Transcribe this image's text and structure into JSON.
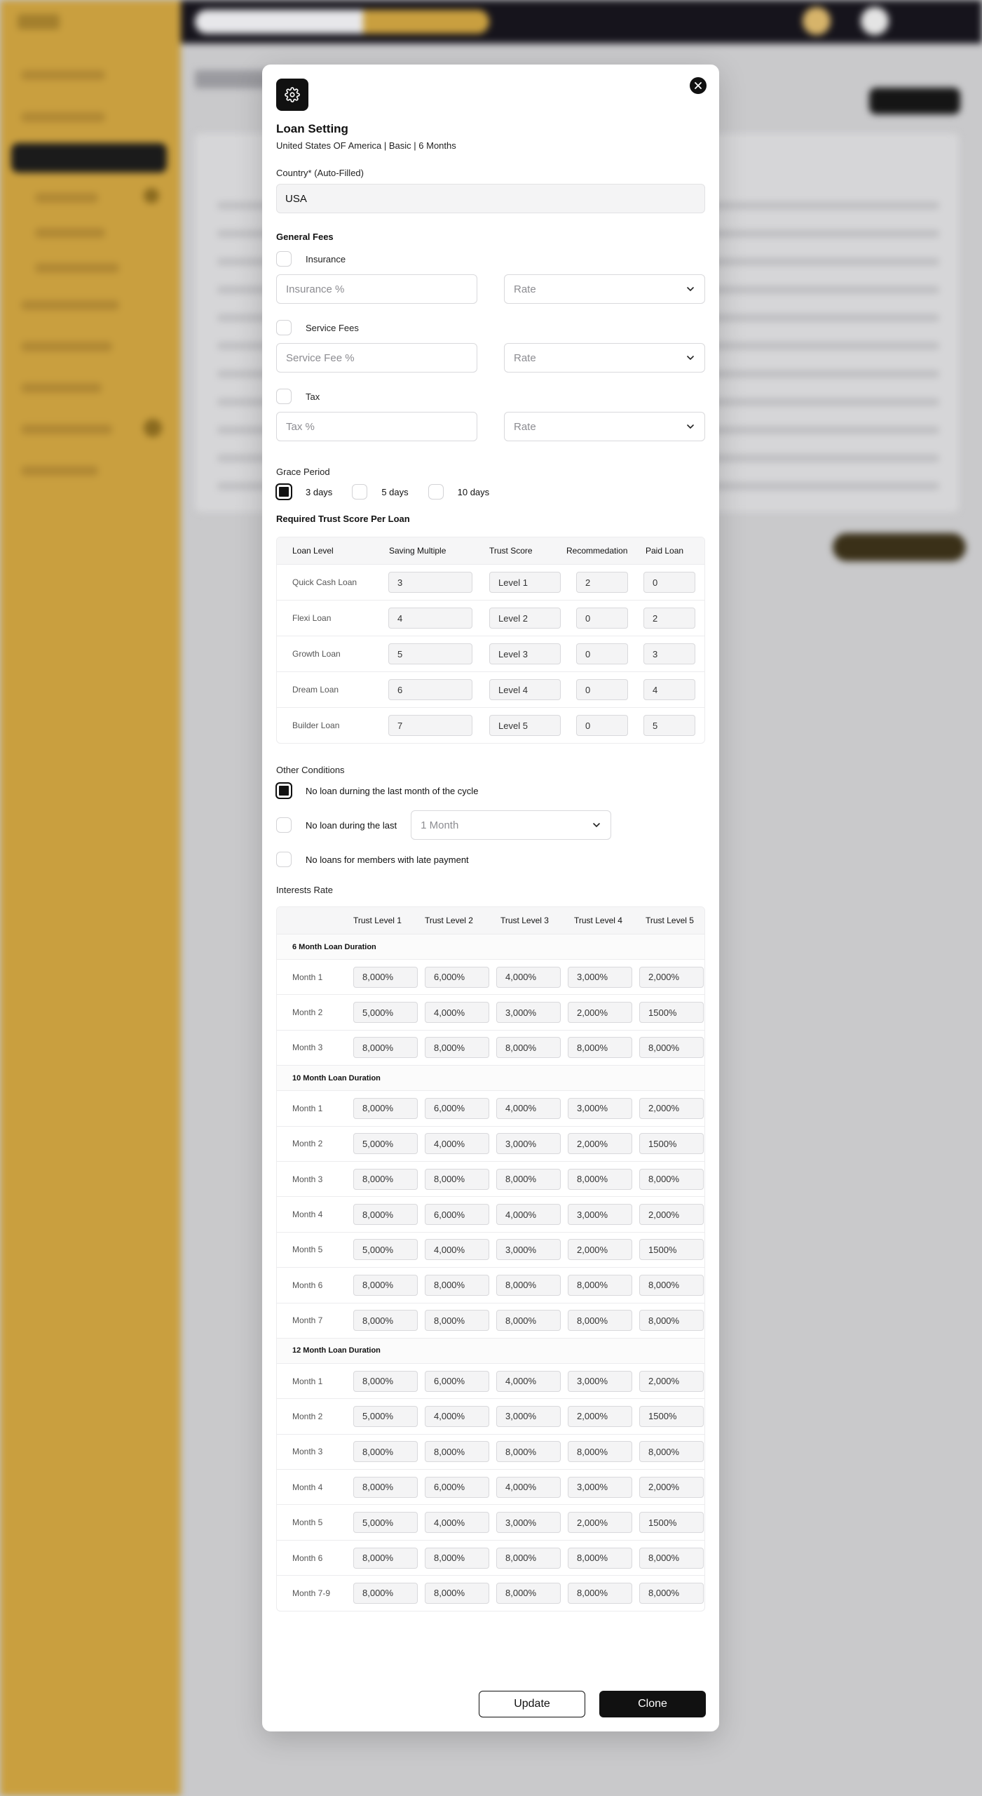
{
  "modal": {
    "title": "Loan Setting",
    "subtitle": "United States OF America | Basic | 6 Months",
    "country_label": "Country* (Auto-Filled)",
    "country_value": "USA"
  },
  "general_fees": {
    "label": "General Fees",
    "items": [
      {
        "name": "Insurance",
        "placeholder": "Insurance %",
        "select": "Rate"
      },
      {
        "name": "Service Fees",
        "placeholder": "Service Fee %",
        "select": "Rate"
      },
      {
        "name": "Tax",
        "placeholder": "Tax %",
        "select": "Rate"
      }
    ]
  },
  "grace_period": {
    "label": "Grace Period",
    "options": [
      "3 days",
      "5 days",
      "10 days"
    ],
    "selected": "3 days"
  },
  "trust_score": {
    "label": "Required Trust Score Per Loan",
    "headers": [
      "Loan Level",
      "Saving Multiple",
      "Trust Score",
      "Recommedation",
      "Paid Loan"
    ],
    "rows": [
      {
        "level": "Quick Cash Loan",
        "saving": "3",
        "trust": "Level 1",
        "rec": "2",
        "paid": "0"
      },
      {
        "level": "Flexi Loan",
        "saving": "4",
        "trust": "Level 2",
        "rec": "0",
        "paid": "2"
      },
      {
        "level": "Growth Loan",
        "saving": "5",
        "trust": "Level 3",
        "rec": "0",
        "paid": "3"
      },
      {
        "level": "Dream Loan",
        "saving": "6",
        "trust": "Level 4",
        "rec": "0",
        "paid": "4"
      },
      {
        "level": "Builder Loan",
        "saving": "7",
        "trust": "Level 5",
        "rec": "0",
        "paid": "5"
      }
    ]
  },
  "other_conditions": {
    "label": "Other Conditions",
    "last_month": "No loan durning the last month of the cycle",
    "during_last": "No loan during the last",
    "during_last_value": "1 Month",
    "late_payment": "No loans for members with late payment"
  },
  "interest_rate": {
    "label": "Interests Rate",
    "headers": [
      "Trust Level 1",
      "Trust Level 2",
      "Trust Level 3",
      "Trust Level 4",
      "Trust Level 5"
    ],
    "groups": [
      {
        "title": "6 Month Loan Duration",
        "rows": [
          {
            "month": "Month 1",
            "values": [
              "8,000%",
              "6,000%",
              "4,000%",
              "3,000%",
              "2,000%"
            ]
          },
          {
            "month": "Month 2",
            "values": [
              "5,000%",
              "4,000%",
              "3,000%",
              "2,000%",
              "1500%"
            ]
          },
          {
            "month": "Month 3",
            "values": [
              "8,000%",
              "8,000%",
              "8,000%",
              "8,000%",
              "8,000%"
            ]
          }
        ]
      },
      {
        "title": "10 Month Loan Duration",
        "rows": [
          {
            "month": "Month 1",
            "values": [
              "8,000%",
              "6,000%",
              "4,000%",
              "3,000%",
              "2,000%"
            ]
          },
          {
            "month": "Month 2",
            "values": [
              "5,000%",
              "4,000%",
              "3,000%",
              "2,000%",
              "1500%"
            ]
          },
          {
            "month": "Month 3",
            "values": [
              "8,000%",
              "8,000%",
              "8,000%",
              "8,000%",
              "8,000%"
            ]
          },
          {
            "month": "Month 4",
            "values": [
              "8,000%",
              "6,000%",
              "4,000%",
              "3,000%",
              "2,000%"
            ]
          },
          {
            "month": "Month 5",
            "values": [
              "5,000%",
              "4,000%",
              "3,000%",
              "2,000%",
              "1500%"
            ]
          },
          {
            "month": "Month 6",
            "values": [
              "8,000%",
              "8,000%",
              "8,000%",
              "8,000%",
              "8,000%"
            ]
          },
          {
            "month": "Month 7",
            "values": [
              "8,000%",
              "8,000%",
              "8,000%",
              "8,000%",
              "8,000%"
            ]
          }
        ]
      },
      {
        "title": "12 Month Loan Duration",
        "rows": [
          {
            "month": "Month 1",
            "values": [
              "8,000%",
              "6,000%",
              "4,000%",
              "3,000%",
              "2,000%"
            ]
          },
          {
            "month": "Month 2",
            "values": [
              "5,000%",
              "4,000%",
              "3,000%",
              "2,000%",
              "1500%"
            ]
          },
          {
            "month": "Month 3",
            "values": [
              "8,000%",
              "8,000%",
              "8,000%",
              "8,000%",
              "8,000%"
            ]
          },
          {
            "month": "Month 4",
            "values": [
              "8,000%",
              "6,000%",
              "4,000%",
              "3,000%",
              "2,000%"
            ]
          },
          {
            "month": "Month 5",
            "values": [
              "5,000%",
              "4,000%",
              "3,000%",
              "2,000%",
              "1500%"
            ]
          },
          {
            "month": "Month 6",
            "values": [
              "8,000%",
              "8,000%",
              "8,000%",
              "8,000%",
              "8,000%"
            ]
          },
          {
            "month": "Month 7-9",
            "values": [
              "8,000%",
              "8,000%",
              "8,000%",
              "8,000%",
              "8,000%"
            ]
          }
        ]
      }
    ]
  },
  "actions": {
    "update": "Update",
    "clone": "Clone"
  },
  "icons": {
    "header": "gear-icon",
    "close": "close-icon",
    "dropdown": "chevron-down-icon"
  },
  "colors": {
    "accent": "#c99f3f",
    "dark": "#111111",
    "topbar": "#16141c"
  }
}
